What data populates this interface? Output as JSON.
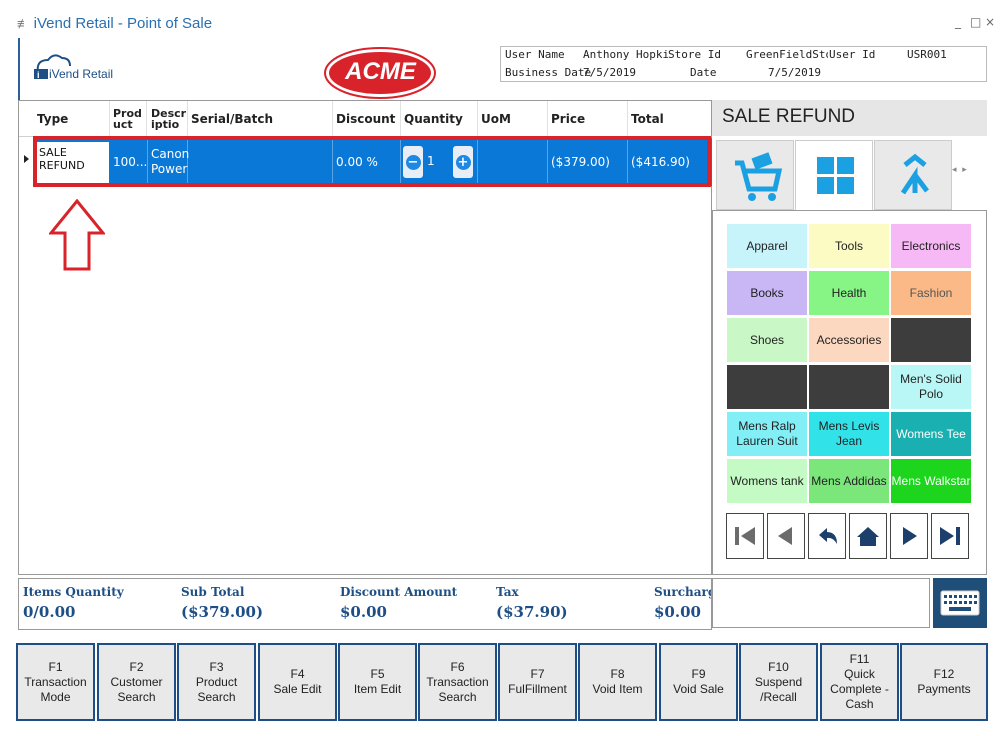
{
  "window": {
    "title": "iVend Retail - Point of Sale",
    "minimize": "_",
    "maximize": "□",
    "close": "×"
  },
  "header": {
    "logo_text": "iVend Retail",
    "acme_text": "ACME",
    "user_name_label": "User Name",
    "user_name": "Anthony Hopkir",
    "store_id_label": "Store Id",
    "store_id": "GreenFieldStor",
    "user_id_label": "User Id",
    "user_id": "USR001",
    "business_date_label": "Business Date",
    "business_date": "7/5/2019",
    "date_label": "Date",
    "date": "7/5/2019"
  },
  "grid": {
    "columns": [
      "Type",
      "Prod uct",
      "Descr iptio",
      "Serial/Batch",
      "Discount",
      "Quantity",
      "UoM",
      "Price",
      "Total"
    ],
    "row": {
      "type": "SALE REFUND",
      "product": "100...",
      "description": "Canon Power",
      "serial": "",
      "discount": "0.00 %",
      "quantity": "1",
      "uom": "",
      "price": "($379.00)",
      "total": "($416.90)"
    }
  },
  "summary": {
    "items_quantity_label": "Items Quantity",
    "items_quantity": "0/0.00",
    "sub_total_label": "Sub Total",
    "sub_total": "($379.00)",
    "discount_label": "Discount Amount",
    "discount": "$0.00",
    "tax_label": "Tax",
    "tax": "($37.90)",
    "surcharge_label": "Surcharg",
    "surcharge": "$0.00"
  },
  "right_panel": {
    "title": "SALE REFUND",
    "tabs": [
      "cart-icon",
      "grid-icon",
      "merge-icon"
    ],
    "categories": [
      {
        "label": "Apparel",
        "color": "#c7f3fb"
      },
      {
        "label": "Tools",
        "color": "#fdfbc4"
      },
      {
        "label": "Electronics",
        "color": "#f7b9f5"
      },
      {
        "label": "Books",
        "color": "#c8b6f5"
      },
      {
        "label": "Health",
        "color": "#86f586"
      },
      {
        "label": "Fashion",
        "color": "#fbb987"
      },
      {
        "label": "Shoes",
        "color": "#c9f7c5"
      },
      {
        "label": "Accessories",
        "color": "#fbd8bf"
      },
      {
        "label": "",
        "color": "#3d3d3d"
      },
      {
        "label": "",
        "color": "#3d3d3d"
      },
      {
        "label": "",
        "color": "#3d3d3d"
      },
      {
        "label": "Men's Solid Polo",
        "color": "#b9f7f7"
      },
      {
        "label": "Mens Ralp Lauren Suit",
        "color": "#82eef6"
      },
      {
        "label": "Mens Levis Jean",
        "color": "#31e3e8"
      },
      {
        "label": "Womens Tee",
        "color": "#1aafb0"
      },
      {
        "label": "Womens tank",
        "color": "#c4fac4"
      },
      {
        "label": "Mens Addidas",
        "color": "#7be77b"
      },
      {
        "label": "Mens Walkstar",
        "color": "#1ed51e"
      }
    ]
  },
  "function_keys": [
    {
      "key": "F1",
      "label": "Transaction\nMode"
    },
    {
      "key": "F2",
      "label": "Customer\nSearch"
    },
    {
      "key": "F3",
      "label": "Product\nSearch"
    },
    {
      "key": "F4",
      "label": "Sale Edit"
    },
    {
      "key": "F5",
      "label": "Item Edit"
    },
    {
      "key": "F6",
      "label": "Transaction\nSearch"
    },
    {
      "key": "F7",
      "label": "FulFillment"
    },
    {
      "key": "F8",
      "label": "Void Item"
    },
    {
      "key": "F9",
      "label": "Void Sale"
    },
    {
      "key": "F10",
      "label": "Suspend\n/Recall"
    },
    {
      "key": "F11",
      "label": "Quick\nComplete -\nCash"
    },
    {
      "key": "F12",
      "label": "Payments"
    }
  ]
}
